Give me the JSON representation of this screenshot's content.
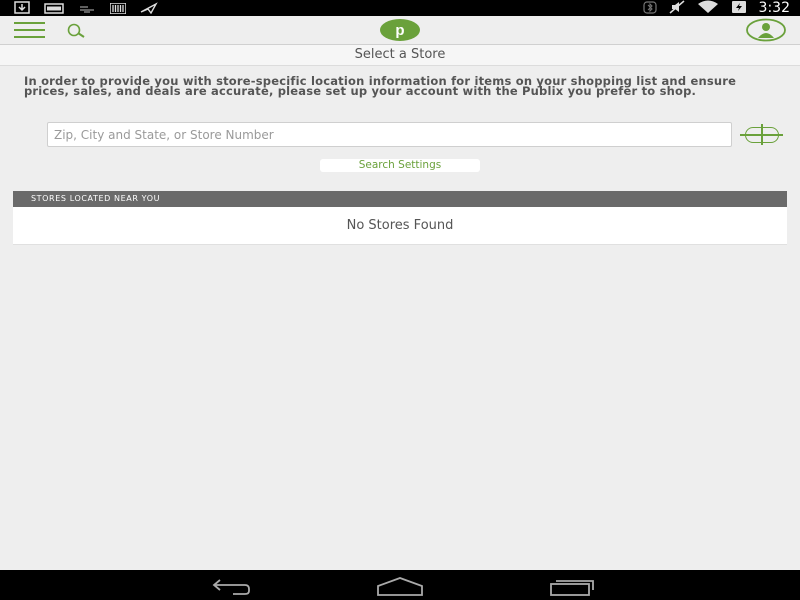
{
  "status_bar": {
    "time": "3:32",
    "left_icons": [
      "download-icon",
      "message-icon",
      "notification-icon",
      "barcode-icon",
      "flight-icon"
    ],
    "right_icons": [
      "bluetooth-icon",
      "mute-icon",
      "wifi-icon",
      "battery-icon"
    ]
  },
  "action_bar": {
    "menu_icon": "hamburger-menu-icon",
    "search_icon": "search-icon",
    "logo_letter": "p",
    "account_icon": "account-icon"
  },
  "page": {
    "title": "Select a Store",
    "intro": "In order to provide you with store-specific location information for items on your shopping list and ensure prices, sales, and deals are accurate, please set up your account with the Publix you prefer to shop."
  },
  "search": {
    "value": "",
    "placeholder": "Zip, City and State, or Store Number",
    "settings_label": "Search Settings"
  },
  "stores": {
    "header": "STORES LOCATED NEAR YOU",
    "empty_message": "No Stores Found"
  },
  "nav_bar": {
    "buttons": [
      "back-icon",
      "home-icon",
      "recent-apps-icon"
    ]
  },
  "colors": {
    "accent": "#6aa13b",
    "header_gray": "#6a6a6a",
    "background": "#eeeeee"
  }
}
